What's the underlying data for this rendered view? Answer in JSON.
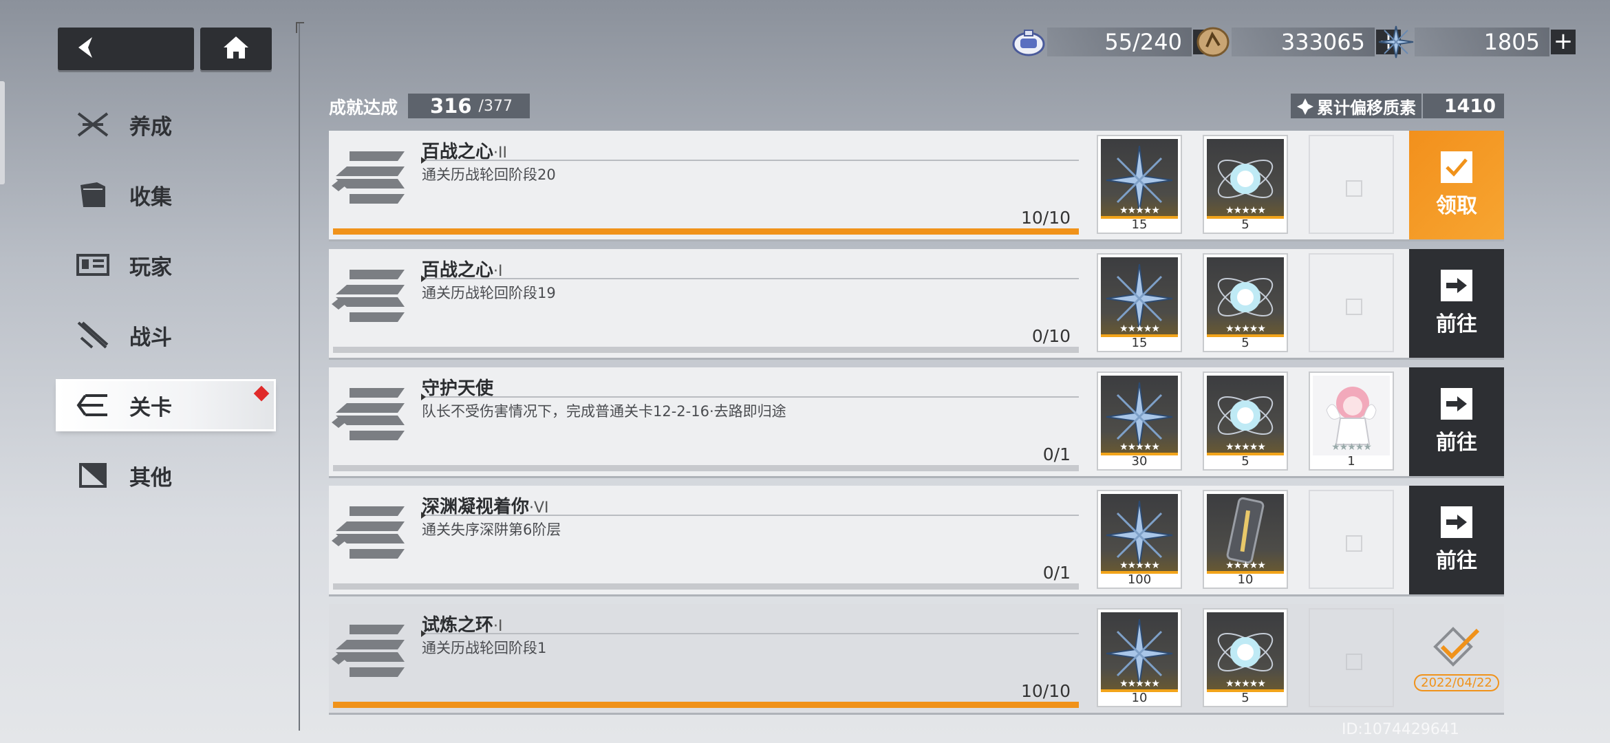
{
  "nav": {
    "back_icon": "back-arrow-icon",
    "home_icon": "home-icon"
  },
  "sidebar": {
    "items": [
      {
        "label": "养成",
        "icon": "crossed-swords-icon",
        "active": false
      },
      {
        "label": "收集",
        "icon": "folder-icon",
        "active": false
      },
      {
        "label": "玩家",
        "icon": "id-card-icon",
        "active": false
      },
      {
        "label": "战斗",
        "icon": "blade-icon",
        "active": false
      },
      {
        "label": "关卡",
        "icon": "stage-icon",
        "active": true,
        "badge": "red-diamond"
      },
      {
        "label": "其他",
        "icon": "flag-icon",
        "active": false
      }
    ]
  },
  "currency": [
    {
      "icon": "stamina-icon",
      "value": "55/240"
    },
    {
      "icon": "coin-icon",
      "value": "333065"
    },
    {
      "icon": "crystal-icon",
      "value": "1805"
    }
  ],
  "achievement": {
    "label": "成就达成",
    "done": "316",
    "total": "/377"
  },
  "accumulated": {
    "label": "累计偏移质素",
    "value": "1410"
  },
  "rows": [
    {
      "title": "百战之心",
      "suffix": "·II",
      "desc": "通关历战轮回阶段20",
      "progress": "10/10",
      "progress_ratio": 1.0,
      "rewards": [
        {
          "icon": "crystal-icon",
          "qty": "15"
        },
        {
          "icon": "energy-orb-icon",
          "qty": "5"
        }
      ],
      "action": {
        "type": "claim",
        "label": "领取"
      },
      "stars": "★★★★★"
    },
    {
      "title": "百战之心",
      "suffix": "·I",
      "desc": "通关历战轮回阶段19",
      "progress": "0/10",
      "progress_ratio": 0,
      "rewards": [
        {
          "icon": "crystal-icon",
          "qty": "15"
        },
        {
          "icon": "energy-orb-icon",
          "qty": "5"
        }
      ],
      "action": {
        "type": "go",
        "label": "前往"
      },
      "stars": "★★★★★"
    },
    {
      "title": "守护天使",
      "suffix": "",
      "desc": "队长不受伤害情况下，完成普通关卡12-2-16·去路即归途",
      "progress": "0/1",
      "progress_ratio": 0,
      "rewards": [
        {
          "icon": "crystal-icon",
          "qty": "30"
        },
        {
          "icon": "energy-orb-icon",
          "qty": "5"
        },
        {
          "icon": "chibi-character-icon",
          "qty": "1"
        }
      ],
      "action": {
        "type": "go",
        "label": "前往"
      },
      "stars": "★★★★★"
    },
    {
      "title": "深渊凝视着你",
      "suffix": "·VI",
      "desc": "通关失序深阱第6阶层",
      "progress": "0/1",
      "progress_ratio": 0,
      "rewards": [
        {
          "icon": "crystal-icon",
          "qty": "100"
        },
        {
          "icon": "capsule-icon",
          "qty": "10"
        }
      ],
      "action": {
        "type": "go",
        "label": "前往"
      },
      "stars": "★★★★★"
    },
    {
      "title": "试炼之环",
      "suffix": "·I",
      "desc": "通关历战轮回阶段1",
      "progress": "10/10",
      "progress_ratio": 1.0,
      "rewards": [
        {
          "icon": "crystal-icon",
          "qty": "10"
        },
        {
          "icon": "energy-orb-icon",
          "qty": "5"
        }
      ],
      "action": {
        "type": "done",
        "date": "2022/04/22"
      },
      "stars": "★★★★★"
    }
  ],
  "uid": "ID:1074429641",
  "colors": {
    "accent": "#f0921a",
    "dark": "#2d2f33",
    "danger": "#e02a2a"
  }
}
